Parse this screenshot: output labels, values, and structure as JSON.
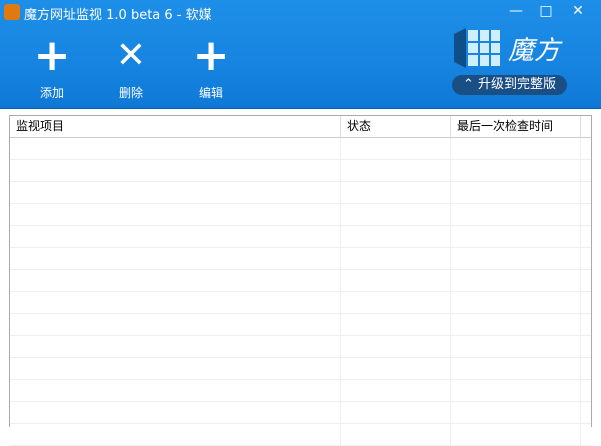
{
  "window": {
    "title": "魔方网址监视 1.0 beta 6 - 软媒",
    "minimize": "—",
    "maximize": "□",
    "close": "✕"
  },
  "toolbar": {
    "add": "添加",
    "delete": "删除",
    "edit": "编辑",
    "add_icon": "+",
    "delete_icon": "✕",
    "edit_icon": "+"
  },
  "brand": {
    "name": "魔方",
    "upgrade": "⌃ 升级到完整版"
  },
  "table": {
    "columns": [
      "监视项目",
      "状态",
      "最后一次检查时间"
    ],
    "rows": []
  }
}
